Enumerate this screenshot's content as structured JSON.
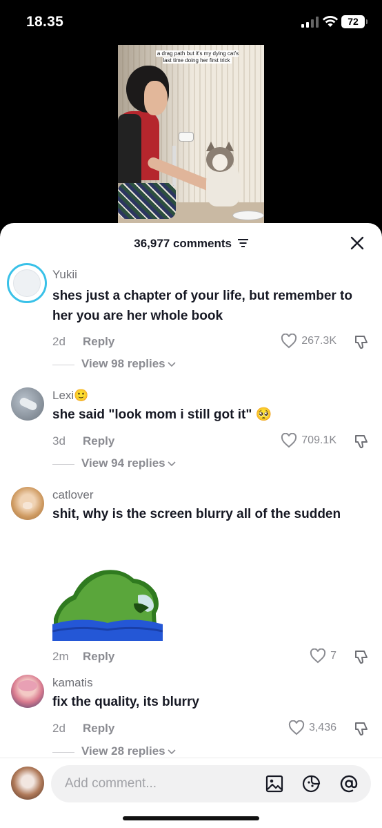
{
  "status_bar": {
    "time": "18.35",
    "battery": "72"
  },
  "video": {
    "caption": "a drag path but it's my dying cat's last time doing her first trick"
  },
  "comments_panel": {
    "count_label": "36,977 comments",
    "comments": [
      {
        "username": "Yukii",
        "text": "shes just a chapter of your life, but remember to her you are her whole book",
        "time": "2d",
        "reply_label": "Reply",
        "likes": "267.3K",
        "view_replies": "View 98 replies"
      },
      {
        "username": "Lexi",
        "username_emoji": "🙂",
        "text": "she said \"look mom i still got it\"",
        "text_emoji": "🥺",
        "time": "3d",
        "reply_label": "Reply",
        "likes": "709.1K",
        "view_replies": "View 94 replies"
      },
      {
        "username": "catlover",
        "text": "shit, why is the screen blurry all of the sudden",
        "time": "2m",
        "reply_label": "Reply",
        "likes": "7"
      },
      {
        "username": "kamatis",
        "text": "fix the quality, its blurry",
        "time": "2d",
        "reply_label": "Reply",
        "likes": "3,436",
        "view_replies": "View 28 replies"
      }
    ]
  },
  "composer": {
    "placeholder": "Add comment..."
  },
  "colors": {
    "text_primary": "#161823",
    "text_secondary": "#8a8b91",
    "accent_ring": "#39c1e8"
  }
}
